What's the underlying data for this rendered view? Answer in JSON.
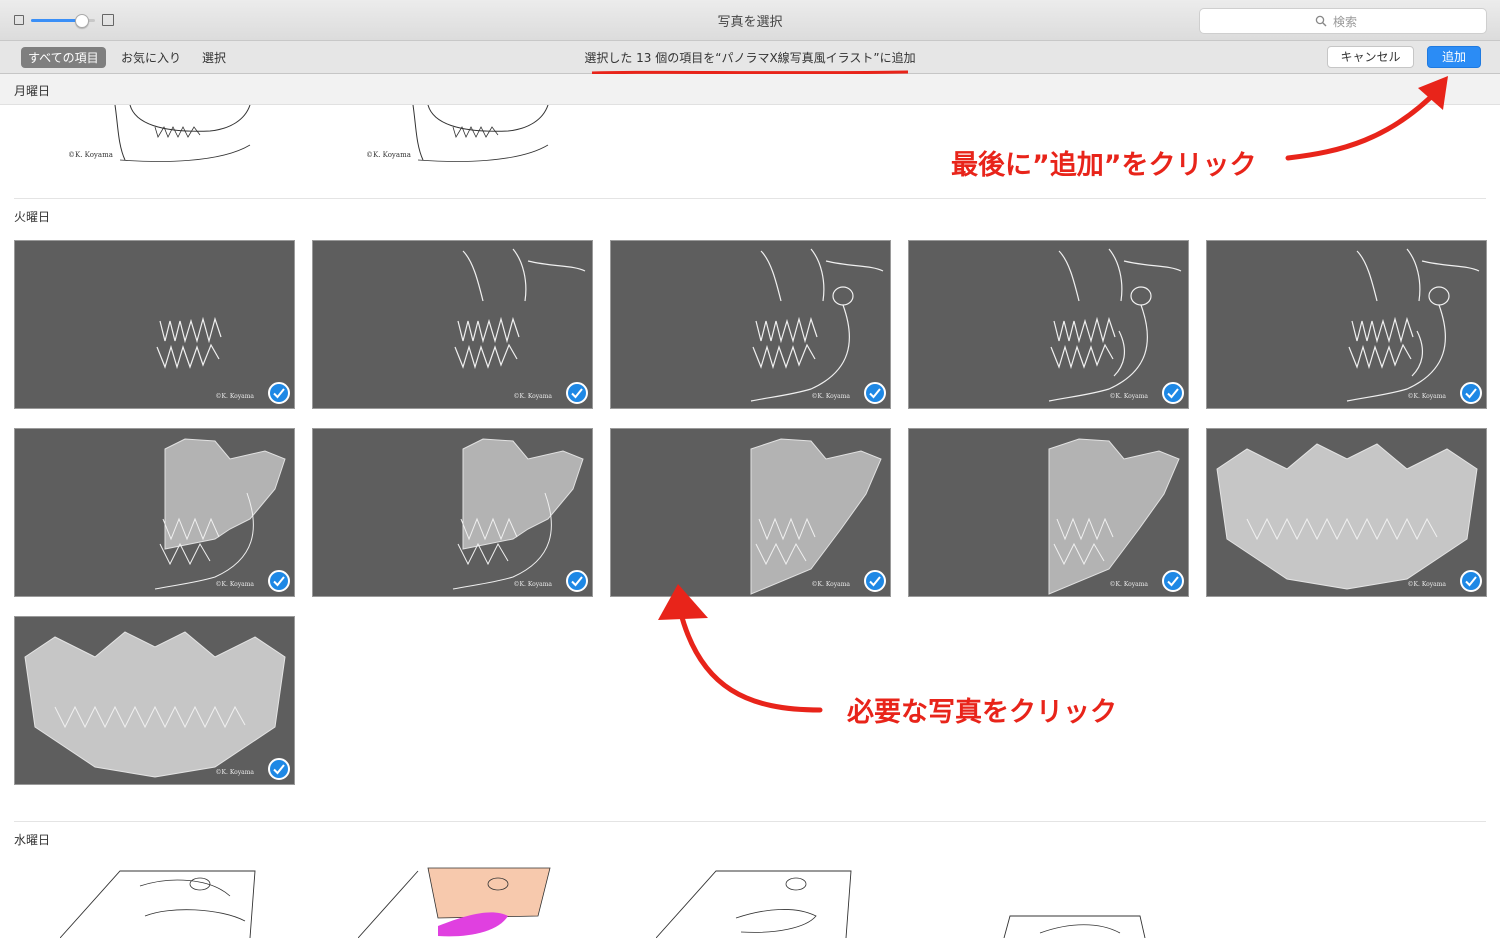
{
  "window": {
    "title": "写真を選択"
  },
  "search": {
    "placeholder": "検索"
  },
  "zoom": {
    "value_fraction": 0.78
  },
  "toolbar": {
    "segments": [
      "すべての項目",
      "お気に入り",
      "選択"
    ],
    "status": "選択した 13 個の項目を“パノラマX線写真風イラスト”に追加",
    "cancel_label": "キャンセル",
    "add_label": "追加"
  },
  "sections": {
    "monday": "月曜日",
    "tuesday": "火曜日",
    "wednesday": "水曜日"
  },
  "monday_items": [
    {
      "copyright": "©K. Koyama"
    },
    {
      "copyright": "©K. Koyama"
    }
  ],
  "tuesday_items": [
    {
      "copyright": "©K. Koyama",
      "selected": true,
      "icon": "checkmark-icon"
    },
    {
      "copyright": "©K. Koyama",
      "selected": true,
      "icon": "checkmark-icon"
    },
    {
      "copyright": "©K. Koyama",
      "selected": true,
      "icon": "checkmark-icon"
    },
    {
      "copyright": "©K. Koyama",
      "selected": true,
      "icon": "checkmark-icon"
    },
    {
      "copyright": "©K. Koyama",
      "selected": true,
      "icon": "checkmark-icon"
    },
    {
      "copyright": "©K. Koyama",
      "selected": true,
      "icon": "checkmark-icon"
    },
    {
      "copyright": "©K. Koyama",
      "selected": true,
      "icon": "checkmark-icon"
    },
    {
      "copyright": "©K. Koyama",
      "selected": true,
      "icon": "checkmark-icon"
    },
    {
      "copyright": "©K. Koyama",
      "selected": true,
      "icon": "checkmark-icon"
    },
    {
      "copyright": "©K. Koyama",
      "selected": true,
      "icon": "checkmark-icon"
    },
    {
      "copyright": "©K. Koyama",
      "selected": true,
      "icon": "checkmark-icon"
    }
  ],
  "annotations": {
    "add_hint": "最後に”追加”をクリック",
    "select_hint": "必要な写真をクリック"
  },
  "colors": {
    "accent": "#2b8cf5",
    "annotation": "#e8241a",
    "tile_bg": "#5e5e5e"
  }
}
